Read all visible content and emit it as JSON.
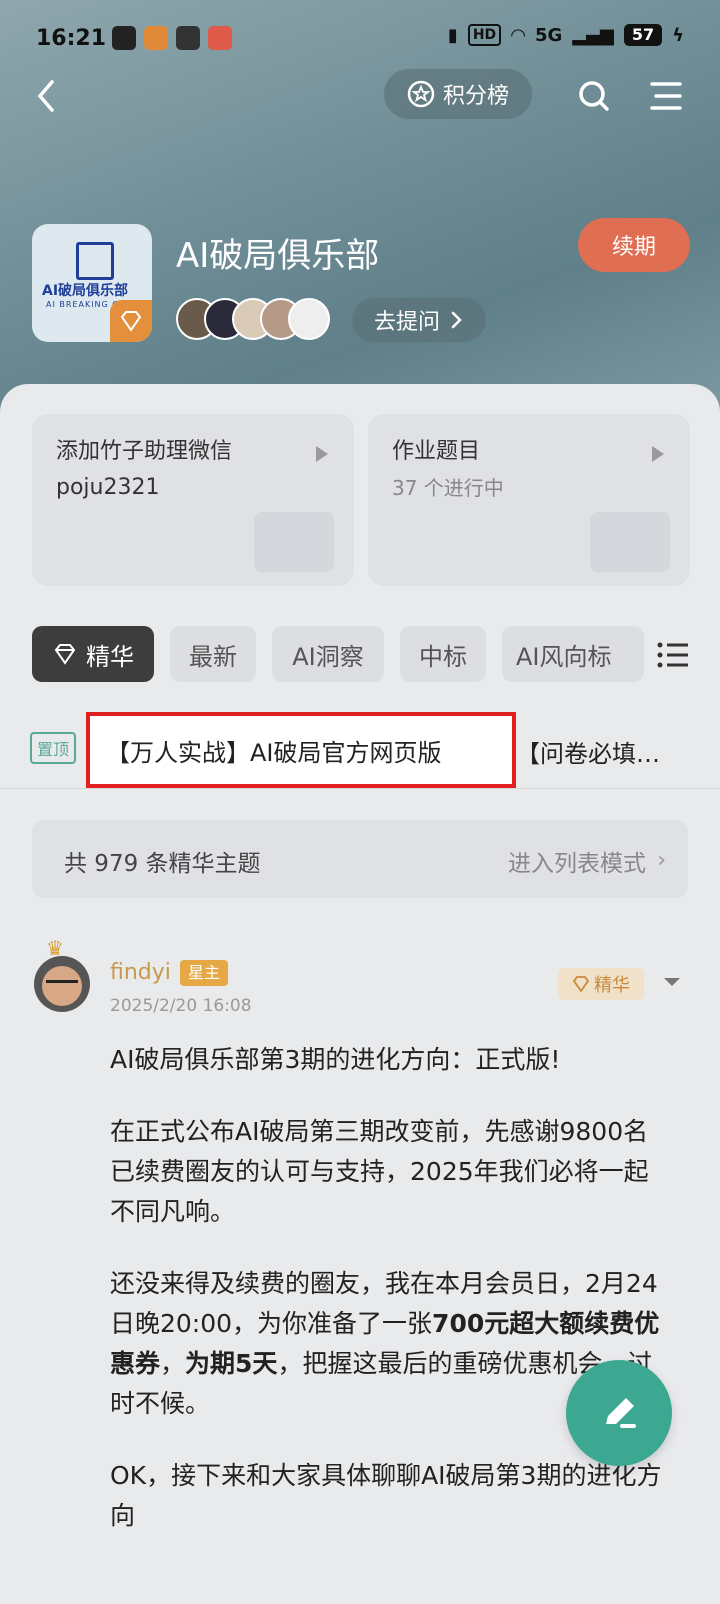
{
  "status_bar": {
    "time": "16:21",
    "hd": "HD",
    "network": "5G",
    "battery": "57"
  },
  "header": {
    "rank_label": "积分榜"
  },
  "group": {
    "logo_line1": "AI破局俱乐部",
    "logo_line2": "AI BREAKING CLUB",
    "title": "AI破局俱乐部",
    "renew_label": "续期",
    "ask_label": "去提问"
  },
  "cards": [
    {
      "title_line1": "添加竹子助理微信",
      "title_line2": "poju2321"
    },
    {
      "title": "作业题目",
      "sub": "37 个进行中"
    }
  ],
  "tabs": [
    "精华",
    "最新",
    "AI洞察",
    "中标",
    "AI风向标"
  ],
  "pinned": {
    "tag": "置顶",
    "main": "【万人实战】AI破局官方网页版",
    "next": "【问卷必填…"
  },
  "summary": {
    "count_text": "共 979 条精华主题",
    "list_mode": "进入列表模式"
  },
  "post": {
    "author": "findyi",
    "role": "星主",
    "time": "2025/2/20 16:08",
    "badge": "精华",
    "p1": "AI破局俱乐部第3期的进化方向：正式版!",
    "p2": "在正式公布AI破局第三期改变前，先感谢9800名已续费圈友的认可与支持，2025年我们必将一起不同凡响。",
    "p3_a": "还没来得及续费的圈友，我在本月会员日，2月24日晚20:00，为你准备了一张",
    "p3_bold1": "700元超大额续费优惠券",
    "p3_b": "，",
    "p3_bold2": "为期5天",
    "p3_c": "，把握这最后的重磅优惠机会，过时不候。",
    "p4": "OK，接下来和大家具体聊聊AI破局第3期的进化方向"
  }
}
